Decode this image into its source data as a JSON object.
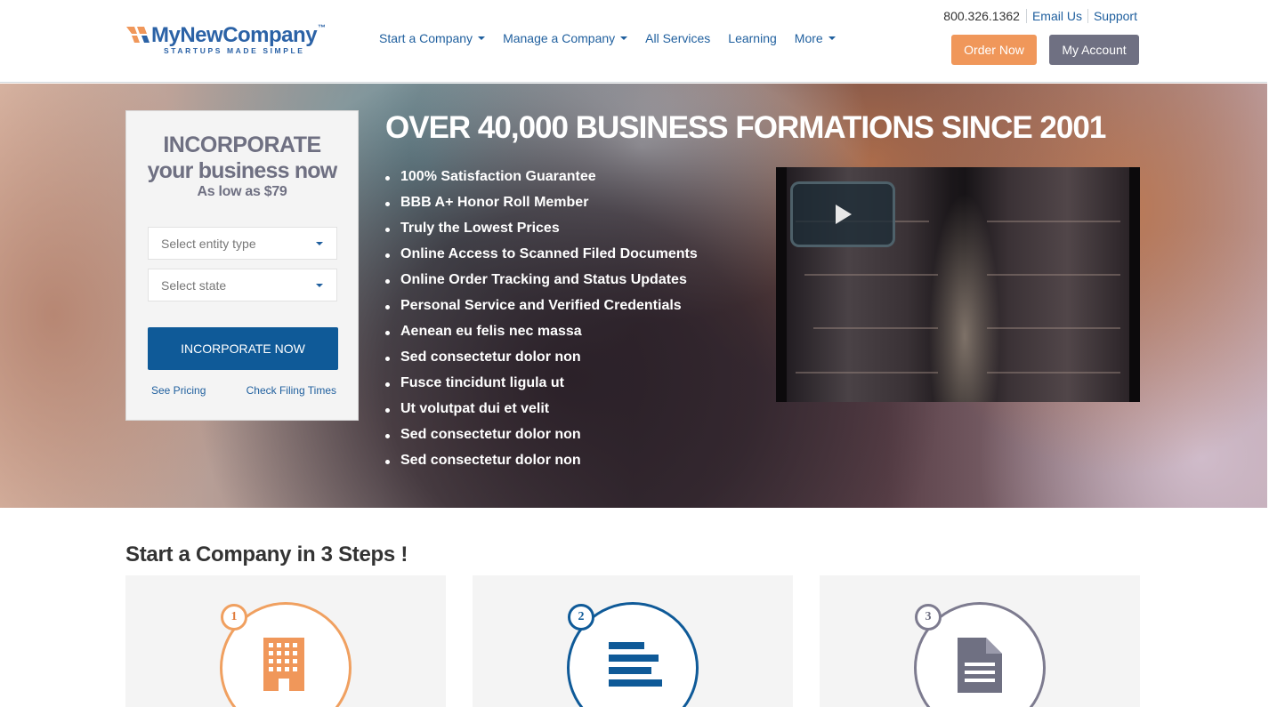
{
  "header": {
    "logo": {
      "word": "MyNewCompany",
      "tm": "™",
      "tagline": "STARTUPS MADE SIMPLE"
    },
    "nav": [
      {
        "label": "Start a Company",
        "dropdown": true
      },
      {
        "label": "Manage a Company",
        "dropdown": true
      },
      {
        "label": "All Services",
        "dropdown": false
      },
      {
        "label": "Learning",
        "dropdown": false
      },
      {
        "label": "More",
        "dropdown": true
      }
    ],
    "phone": "800.326.1362",
    "email_label": "Email Us",
    "support_label": "Support",
    "order_label": "Order Now",
    "account_label": "My Account"
  },
  "hero": {
    "card": {
      "title_line1": "INCORPORATE",
      "title_line2": "your business now",
      "price_line": "As low as $79",
      "entity_placeholder": "Select entity type",
      "state_placeholder": "Select state",
      "button_label": "INCORPORATE NOW",
      "link_pricing": "See Pricing",
      "link_filing": "Check Filing Times"
    },
    "headline": "OVER 40,000 BUSINESS FORMATIONS SINCE 2001",
    "features": [
      "100% Satisfaction Guarantee",
      "BBB A+ Honor Roll Member",
      "Truly the Lowest Prices",
      "Online Access to Scanned Filed Documents",
      "Online Order Tracking and Status Updates",
      "Personal Service and Verified Credentials",
      "Aenean eu felis nec massa",
      "Sed consectetur dolor non",
      "Fusce tincidunt ligula ut",
      "Ut volutpat dui et velit",
      "Sed consectetur dolor non",
      "Sed consectetur dolor non"
    ]
  },
  "steps": {
    "title": "Start a Company in 3 Steps !",
    "items": [
      {
        "number": "1",
        "icon": "building-icon",
        "color": "#f0a060"
      },
      {
        "number": "2",
        "icon": "lines-icon",
        "color": "#0f5a98"
      },
      {
        "number": "3",
        "icon": "document-icon",
        "color": "#7d7b8f"
      }
    ]
  },
  "colors": {
    "brand_blue": "#2b62a6",
    "link_blue": "#1f5f9e",
    "primary_button": "#0f5a98",
    "order_orange": "#f0975a",
    "account_gray": "#6f7082"
  }
}
